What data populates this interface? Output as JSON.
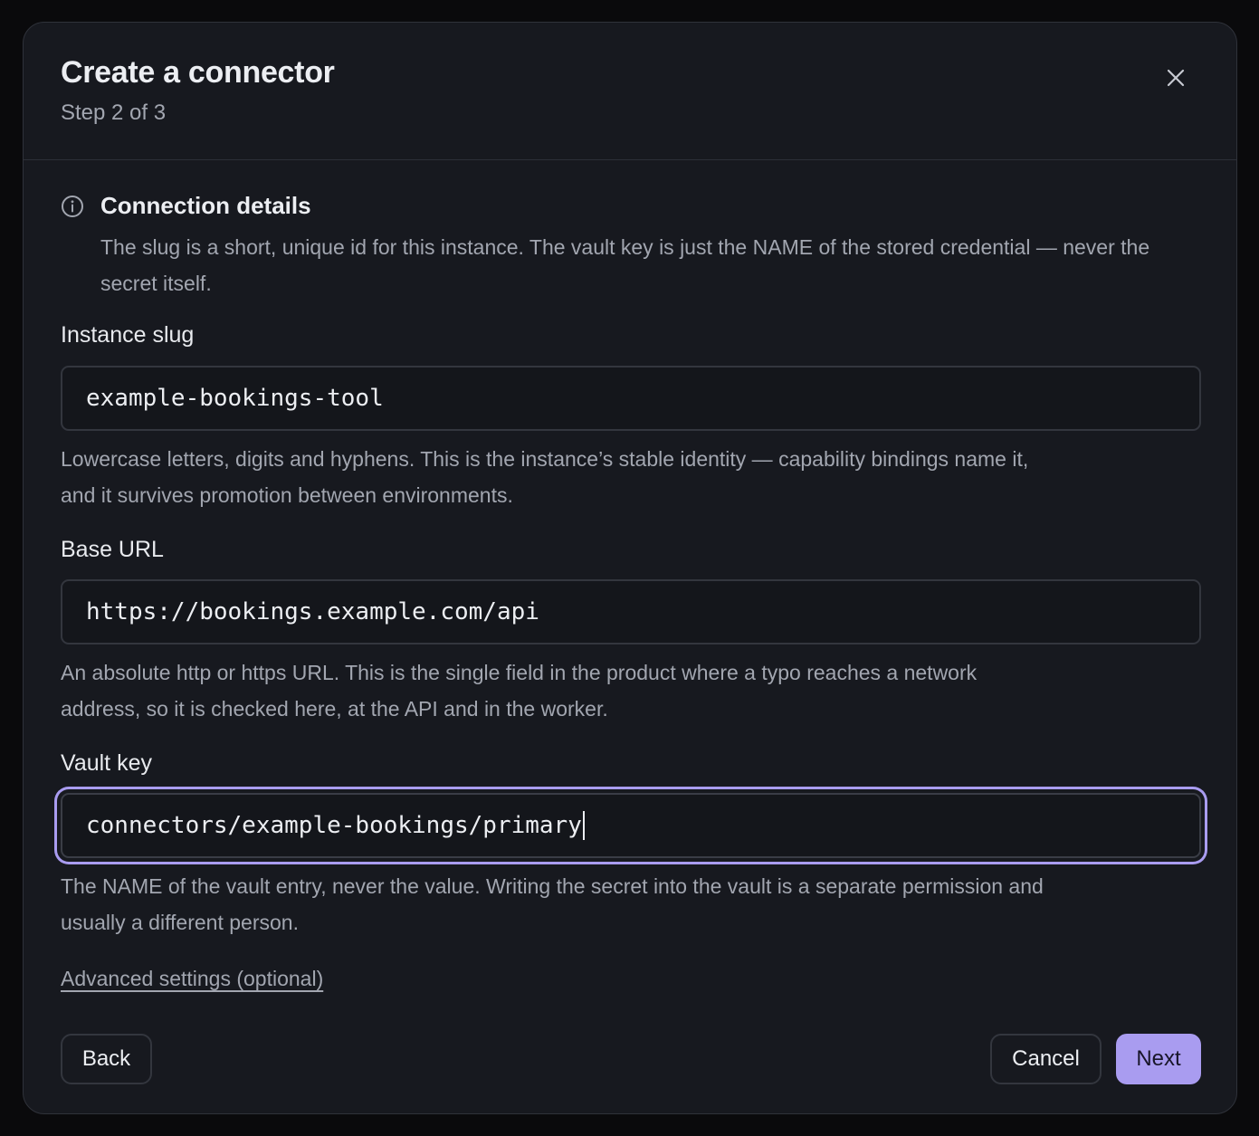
{
  "dialog": {
    "title": "Create a connector",
    "step": "Step 2 of 3",
    "close_icon": "close-icon"
  },
  "info": {
    "icon": "info-icon",
    "title": "Connection details",
    "text": "The slug is a short, unique id for this instance. The vault key is just the NAME of the stored credential — never the secret itself."
  },
  "fields": {
    "slug": {
      "label": "Instance slug",
      "value": "example-bookings-tool",
      "help": "Lowercase letters, digits and hyphens. This is the instance’s stable identity — capability bindings name it, and it survives promotion between environments."
    },
    "base_url": {
      "label": "Base URL",
      "value": "https://bookings.example.com/api",
      "help": "An absolute http or https URL. This is the single field in the product where a typo reaches a network address, so it is checked here, at the API and in the worker."
    },
    "vault_key": {
      "label": "Vault key",
      "value": "connectors/example-bookings/primary",
      "help": "The NAME of the vault entry, never the value. Writing the secret into the vault is a separate permission and usually a different person."
    }
  },
  "advanced_link": "Advanced settings (optional)",
  "buttons": {
    "back": "Back",
    "cancel": "Cancel",
    "next": "Next"
  },
  "colors": {
    "accent": "#a99cf0",
    "background": "#17191f"
  }
}
